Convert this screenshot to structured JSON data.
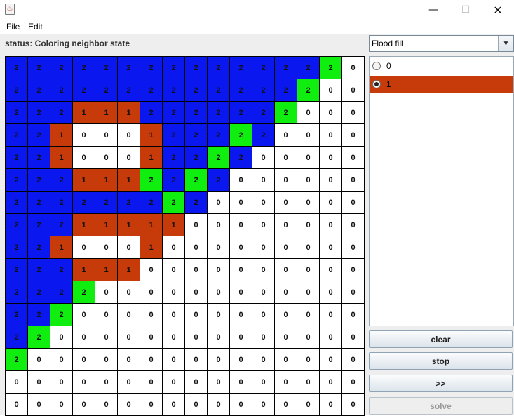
{
  "window": {
    "minimize_glyph": "—",
    "maximize_glyph": "☐",
    "close_glyph": "✕",
    "icon": "java-cup-icon"
  },
  "menu": {
    "file": "File",
    "edit": "Edit"
  },
  "status": "status: Coloring neighbor state",
  "mode_select": {
    "value": "Flood fill",
    "arrow": "▼"
  },
  "palette": [
    {
      "label": "0",
      "selected": false
    },
    {
      "label": "1",
      "selected": true
    }
  ],
  "colors": {
    "0": "#ffffff",
    "1": "#c73a09",
    "2": "#0a17ef",
    "2_frontier": "#10ee10",
    "selected_row": "#c73a09"
  },
  "buttons": {
    "clear": "clear",
    "stop": "stop",
    "step": ">>",
    "solve": "solve"
  },
  "board": {
    "rows": [
      "2222222222222220",
      "2222222222222200",
      "2221112222222000",
      "2210001222220000",
      "2210001222200000",
      "2221112222000000",
      "2222222220000000",
      "2221111100000000",
      "2210001000000000",
      "2221110000000000",
      "2222000000000000",
      "2220000000000000",
      "2200000000000000",
      "2000000000000000",
      "0000000000000000",
      "0000000000000000"
    ],
    "green_cells": [
      [
        0,
        14
      ],
      [
        1,
        13
      ],
      [
        2,
        12
      ],
      [
        3,
        10
      ],
      [
        4,
        9
      ],
      [
        5,
        6
      ],
      [
        5,
        8
      ],
      [
        6,
        7
      ],
      [
        10,
        3
      ],
      [
        11,
        2
      ],
      [
        12,
        1
      ],
      [
        13,
        0
      ]
    ]
  }
}
